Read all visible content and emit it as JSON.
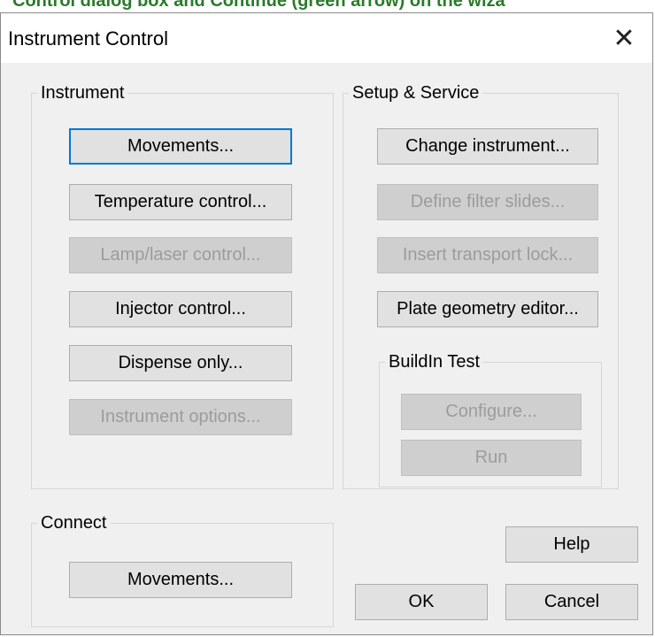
{
  "caption_fragment": "Control dialog box and Continue (green arrow) on the wiza",
  "dialog": {
    "title": "Instrument Control",
    "close_glyph": "✕"
  },
  "instrument": {
    "legend": "Instrument",
    "buttons": [
      {
        "label": "Movements...",
        "enabled": true
      },
      {
        "label": "Temperature control...",
        "enabled": true
      },
      {
        "label": "Lamp/laser control...",
        "enabled": false
      },
      {
        "label": "Injector control...",
        "enabled": true
      },
      {
        "label": "Dispense only...",
        "enabled": true
      },
      {
        "label": "Instrument options...",
        "enabled": false
      }
    ]
  },
  "setup": {
    "legend": "Setup & Service",
    "buttons": [
      {
        "label": "Change instrument...",
        "enabled": true
      },
      {
        "label": "Define filter slides...",
        "enabled": false
      },
      {
        "label": "Insert transport lock...",
        "enabled": false
      },
      {
        "label": "Plate geometry editor...",
        "enabled": true
      }
    ],
    "builtin_test": {
      "legend": "BuildIn Test",
      "configure_label": "Configure...",
      "run_label": "Run"
    }
  },
  "connect": {
    "legend": "Connect",
    "button_label": "Movements..."
  },
  "footer": {
    "help_label": "Help",
    "ok_label": "OK",
    "cancel_label": "Cancel"
  }
}
